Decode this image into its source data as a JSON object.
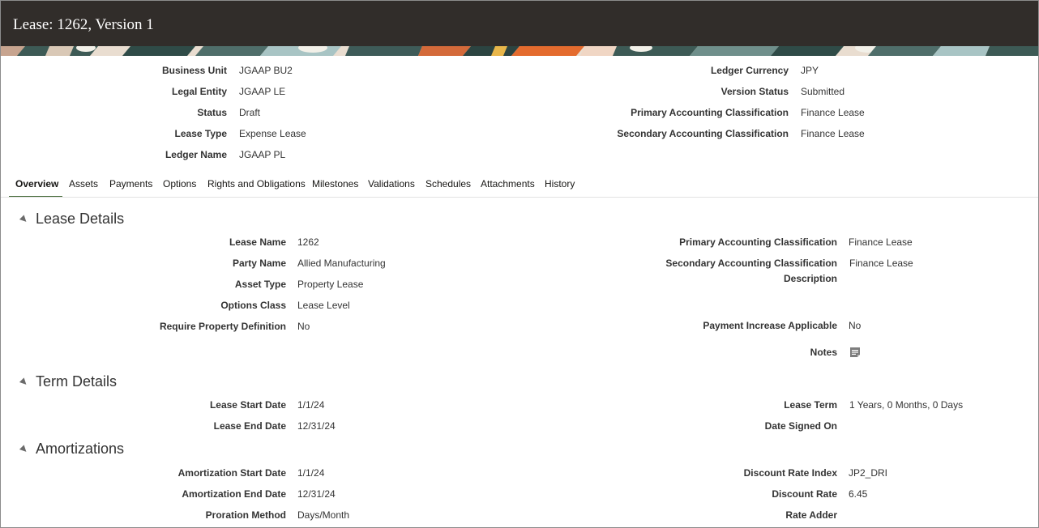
{
  "page": {
    "title": "Lease: 1262, Version 1"
  },
  "header": {
    "left": [
      {
        "label": "Business Unit",
        "value": "JGAAP BU2"
      },
      {
        "label": "Legal Entity",
        "value": "JGAAP LE"
      },
      {
        "label": "Status",
        "value": "Draft"
      },
      {
        "label": "Lease Type",
        "value": "Expense Lease"
      },
      {
        "label": "Ledger Name",
        "value": "JGAAP PL"
      }
    ],
    "right": [
      {
        "label": "Ledger Currency",
        "value": "JPY"
      },
      {
        "label": "Version Status",
        "value": "Submitted"
      },
      {
        "label": "Primary Accounting Classification",
        "value": "Finance Lease"
      },
      {
        "label": "Secondary Accounting Classification",
        "value": "Finance Lease"
      }
    ]
  },
  "tabs": [
    {
      "label": "Overview",
      "active": true
    },
    {
      "label": "Assets"
    },
    {
      "label": "Payments"
    },
    {
      "label": "Options"
    },
    {
      "label": "Rights and Obligations"
    },
    {
      "label": "Milestones"
    },
    {
      "label": "Validations"
    },
    {
      "label": "Schedules"
    },
    {
      "label": "Attachments"
    },
    {
      "label": "History"
    }
  ],
  "lease_details": {
    "heading": "Lease Details",
    "left": [
      {
        "label": "Lease Name",
        "value": "1262"
      },
      {
        "label": "Party Name",
        "value": "Allied Manufacturing"
      },
      {
        "label": "Asset Type",
        "value": "Property Lease"
      },
      {
        "label": "Options Class",
        "value": "Lease Level"
      },
      {
        "label": "Require Property Definition",
        "value": "No"
      }
    ],
    "right": [
      {
        "label": "Primary Accounting Classification",
        "value": "Finance Lease"
      },
      {
        "label": "Secondary Accounting Classification",
        "value": "Finance Lease"
      },
      {
        "label": "Description",
        "value": ""
      },
      {
        "label": "Payment Increase Applicable",
        "value": "No"
      },
      {
        "label": "Notes",
        "icon": "notes-icon"
      }
    ]
  },
  "term_details": {
    "heading": "Term Details",
    "left": [
      {
        "label": "Lease Start Date",
        "value": "1/1/24"
      },
      {
        "label": "Lease End Date",
        "value": "12/31/24"
      }
    ],
    "right": [
      {
        "label": "Lease Term",
        "value": "1 Years, 0 Months, 0 Days"
      },
      {
        "label": "Date Signed On",
        "value": ""
      }
    ]
  },
  "amortizations": {
    "heading": "Amortizations",
    "left": [
      {
        "label": "Amortization Start Date",
        "value": "1/1/24"
      },
      {
        "label": "Amortization End Date",
        "value": "12/31/24"
      },
      {
        "label": "Proration Method",
        "value": "Days/Month"
      }
    ],
    "right": [
      {
        "label": "Discount Rate Index",
        "value": "JP2_DRI"
      },
      {
        "label": "Discount Rate",
        "value": "6.45"
      },
      {
        "label": "Rate Adder",
        "value": ""
      }
    ]
  },
  "colors": {
    "title_bar": "#312d2a",
    "active_tab_underline": "#4b6f3f",
    "text": "#333333"
  }
}
